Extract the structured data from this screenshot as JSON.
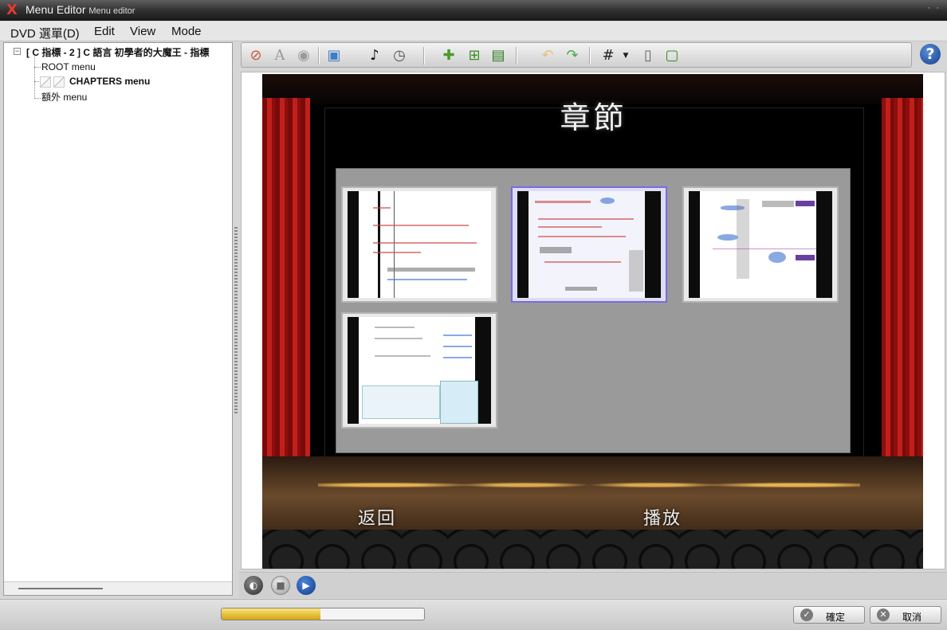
{
  "window": {
    "icon": "app-x-icon",
    "title": "Menu Editor",
    "subtitle": "Menu editor"
  },
  "menubar": {
    "items": [
      "DVD 選單(D)",
      "Edit",
      "View",
      "Mode"
    ]
  },
  "tree": {
    "root": "[ C 指標 - 2 ] C 語言 初學者的大魔王 - 指標",
    "children": [
      "ROOT menu",
      "CHAPTERS menu",
      "額外 menu"
    ],
    "selected": "CHAPTERS menu"
  },
  "toolbar": {
    "icons": [
      "brush-icon",
      "text-icon",
      "eye-icon",
      "background-settings-icon",
      "music-icon",
      "timer-icon",
      "add-item-icon",
      "add-button-icon",
      "add-chapter-icon",
      "undo-icon",
      "redo-icon",
      "grid-icon",
      "grid-dropdown-icon",
      "safe-area-icon",
      "frame-icon"
    ],
    "help_icon": "help-icon"
  },
  "stage": {
    "title": "章節",
    "back_label": "返回",
    "play_label": "播放",
    "thumbnails": [
      {
        "id": "chapter-1",
        "selected": false
      },
      {
        "id": "chapter-2",
        "selected": true
      },
      {
        "id": "chapter-3",
        "selected": false
      },
      {
        "id": "chapter-4",
        "selected": false
      }
    ]
  },
  "player": {
    "icons": [
      "disc-icon",
      "stop-icon",
      "play-icon"
    ]
  },
  "status": {
    "progress_percent": 49,
    "ok_label": "確定",
    "cancel_label": "取消"
  },
  "colors": {
    "accent": "#1d4fa8",
    "curtain": "#c0201a",
    "selection": "#7b6be0",
    "progress": "#e5bf2b"
  }
}
